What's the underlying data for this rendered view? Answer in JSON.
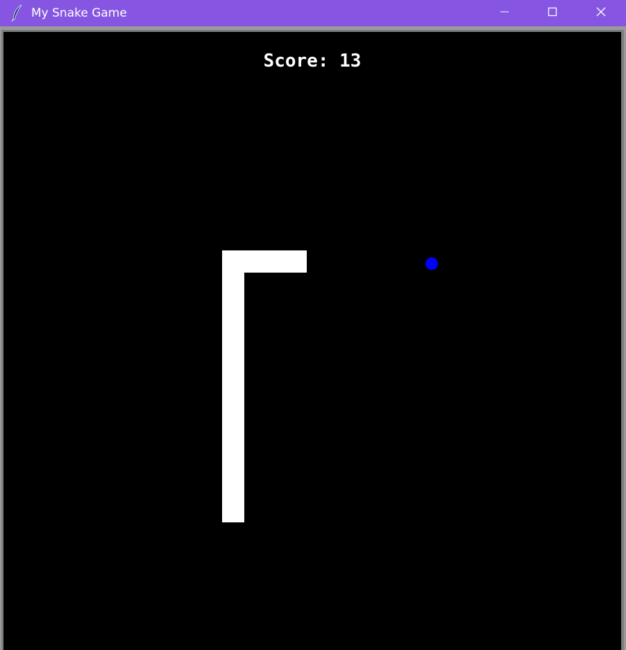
{
  "window": {
    "title": "My Snake Game",
    "titlebar_color": "#8656e2",
    "icons": {
      "app": "feather-icon",
      "minimize": "minimize-icon",
      "maximize": "maximize-icon",
      "close": "close-icon"
    }
  },
  "game": {
    "score_label": "Score:",
    "score_value": 13,
    "score_text": "Score: 13",
    "background_color": "#000000",
    "snake_color": "#ffffff",
    "food_color": "#0000ff"
  }
}
